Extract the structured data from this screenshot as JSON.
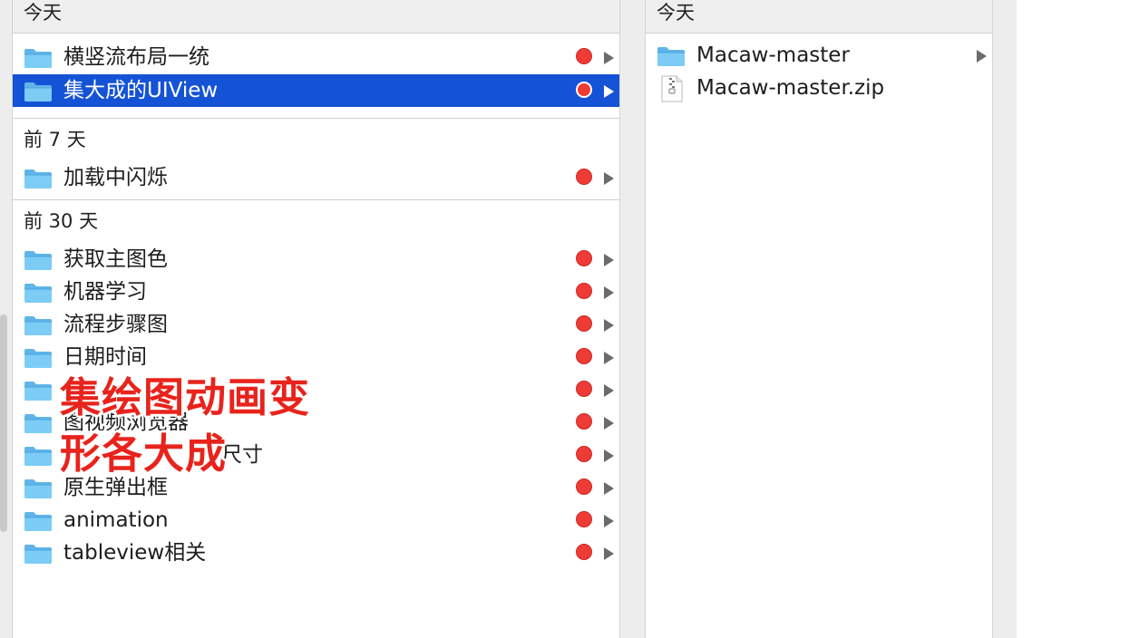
{
  "left_column": {
    "sections": [
      {
        "title": "今天",
        "items": [
          {
            "label": "横竖流布局一统",
            "selected": false
          },
          {
            "label": "集大成的UIView",
            "selected": true
          }
        ]
      },
      {
        "title": "前 7 天",
        "items": [
          {
            "label": "加载中闪烁",
            "selected": false
          }
        ]
      },
      {
        "title": "前 30 天",
        "items": [
          {
            "label": "获取主图色",
            "selected": false
          },
          {
            "label": "机器学习",
            "selected": false
          },
          {
            "label": "流程步骤图",
            "selected": false
          },
          {
            "label": "日期时间",
            "selected": false
          },
          {
            "label": "",
            "selected": false
          },
          {
            "label": "图视频浏览器",
            "selected": false
          },
          {
            "label": "尺寸",
            "selected": false
          },
          {
            "label": "原生弹出框",
            "selected": false
          },
          {
            "label": "animation",
            "selected": false
          },
          {
            "label": "tableview相关",
            "selected": false
          }
        ]
      }
    ]
  },
  "right_column": {
    "section_title": "今天",
    "items": [
      {
        "label": "Macaw-master",
        "type": "folder"
      },
      {
        "label": "Macaw-master.zip",
        "type": "zip"
      }
    ]
  },
  "overlay": {
    "line1": "集绘图动画变",
    "line2": "形各大成"
  },
  "colors": {
    "selection": "#1553d6",
    "tag_red": "#ef3b36",
    "folder_blue": "#6cc0f2",
    "overlay_red": "#e8231c"
  }
}
